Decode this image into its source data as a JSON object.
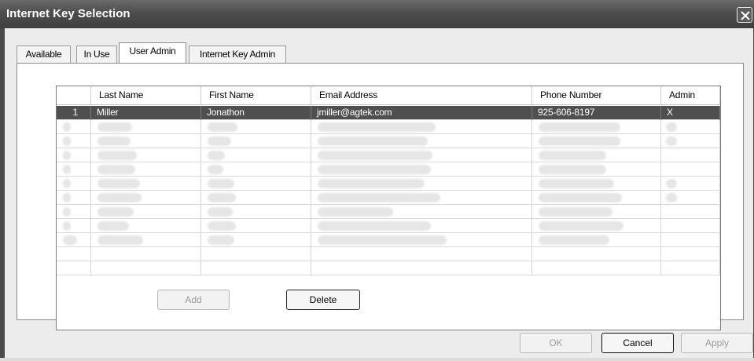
{
  "window": {
    "title": "Internet Key Selection"
  },
  "tabs": [
    {
      "label": "Available"
    },
    {
      "label": "In Use"
    },
    {
      "label": "User Admin"
    },
    {
      "label": "Internet Key Admin"
    }
  ],
  "table": {
    "headers": [
      "",
      "Last Name",
      "First Name",
      "Email Address",
      "Phone Number",
      "Admin"
    ],
    "rows": [
      {
        "num": "1",
        "last": "Miller",
        "first": "Jonathon",
        "email": "jmiller@agtek.com",
        "phone": "925-606-8197",
        "admin": "X"
      }
    ]
  },
  "buttons": {
    "add": "Add",
    "delete": "Delete",
    "ok": "OK",
    "cancel": "Cancel",
    "apply": "Apply"
  }
}
